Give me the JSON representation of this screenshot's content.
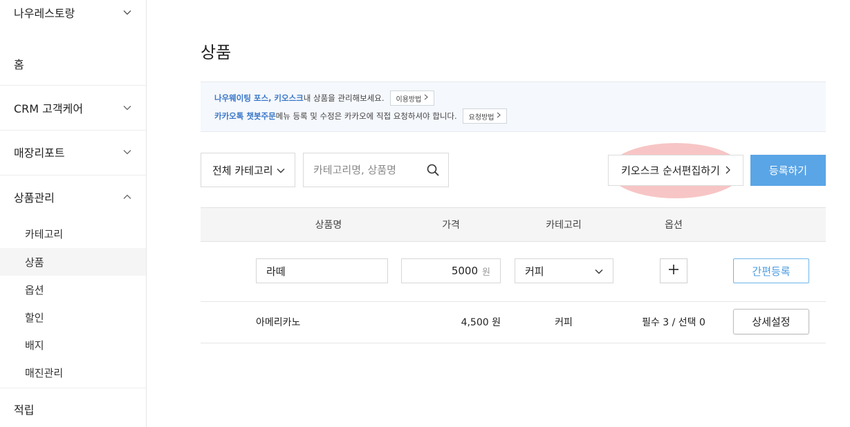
{
  "sidebar": {
    "store_name": "나우레스토랑",
    "items": [
      {
        "label": "홈"
      },
      {
        "label": "CRM 고객케어"
      },
      {
        "label": "매장리포트"
      },
      {
        "label": "상품관리"
      },
      {
        "label": "적립"
      }
    ],
    "sub_items": [
      {
        "label": "카테고리"
      },
      {
        "label": "상품",
        "active": true
      },
      {
        "label": "옵션"
      },
      {
        "label": "할인"
      },
      {
        "label": "배지"
      },
      {
        "label": "매진관리"
      }
    ]
  },
  "main": {
    "title": "상품",
    "notice": {
      "line1": {
        "highlight": "나우웨이팅 포스, 키오스크",
        "text": " 내 상품을 관리해보세요.",
        "button": "이용방법"
      },
      "line2": {
        "highlight": "카카오톡 챗봇주문",
        "text": " 메뉴 등록 및 수정은 카카오에 직접 요청하셔야 합니다.",
        "button": "요청방법"
      }
    },
    "category_select": "전체 카테고리",
    "search": {
      "placeholder": "카테고리명, 상품명",
      "value": ""
    },
    "kiosk_button": "키오스크 순서편집하기",
    "register_button": "등록하기",
    "table": {
      "headers": [
        "상품명",
        "가격",
        "카테고리",
        "옵션"
      ],
      "quick_row": {
        "name": "라떼",
        "price": "5000",
        "price_unit": "원",
        "category": "커피",
        "button": "간편등록"
      },
      "rows": [
        {
          "name": "아메리카노",
          "price": "4,500 원",
          "category": "커피",
          "options": "필수 3 / 선택 0",
          "button": "상세설정"
        }
      ]
    }
  },
  "colors": {
    "accent": "#5aa5e6",
    "highlight_overlay": "#f09696",
    "notice_bg": "#f5f8fc",
    "notice_link": "#3a77c9"
  }
}
